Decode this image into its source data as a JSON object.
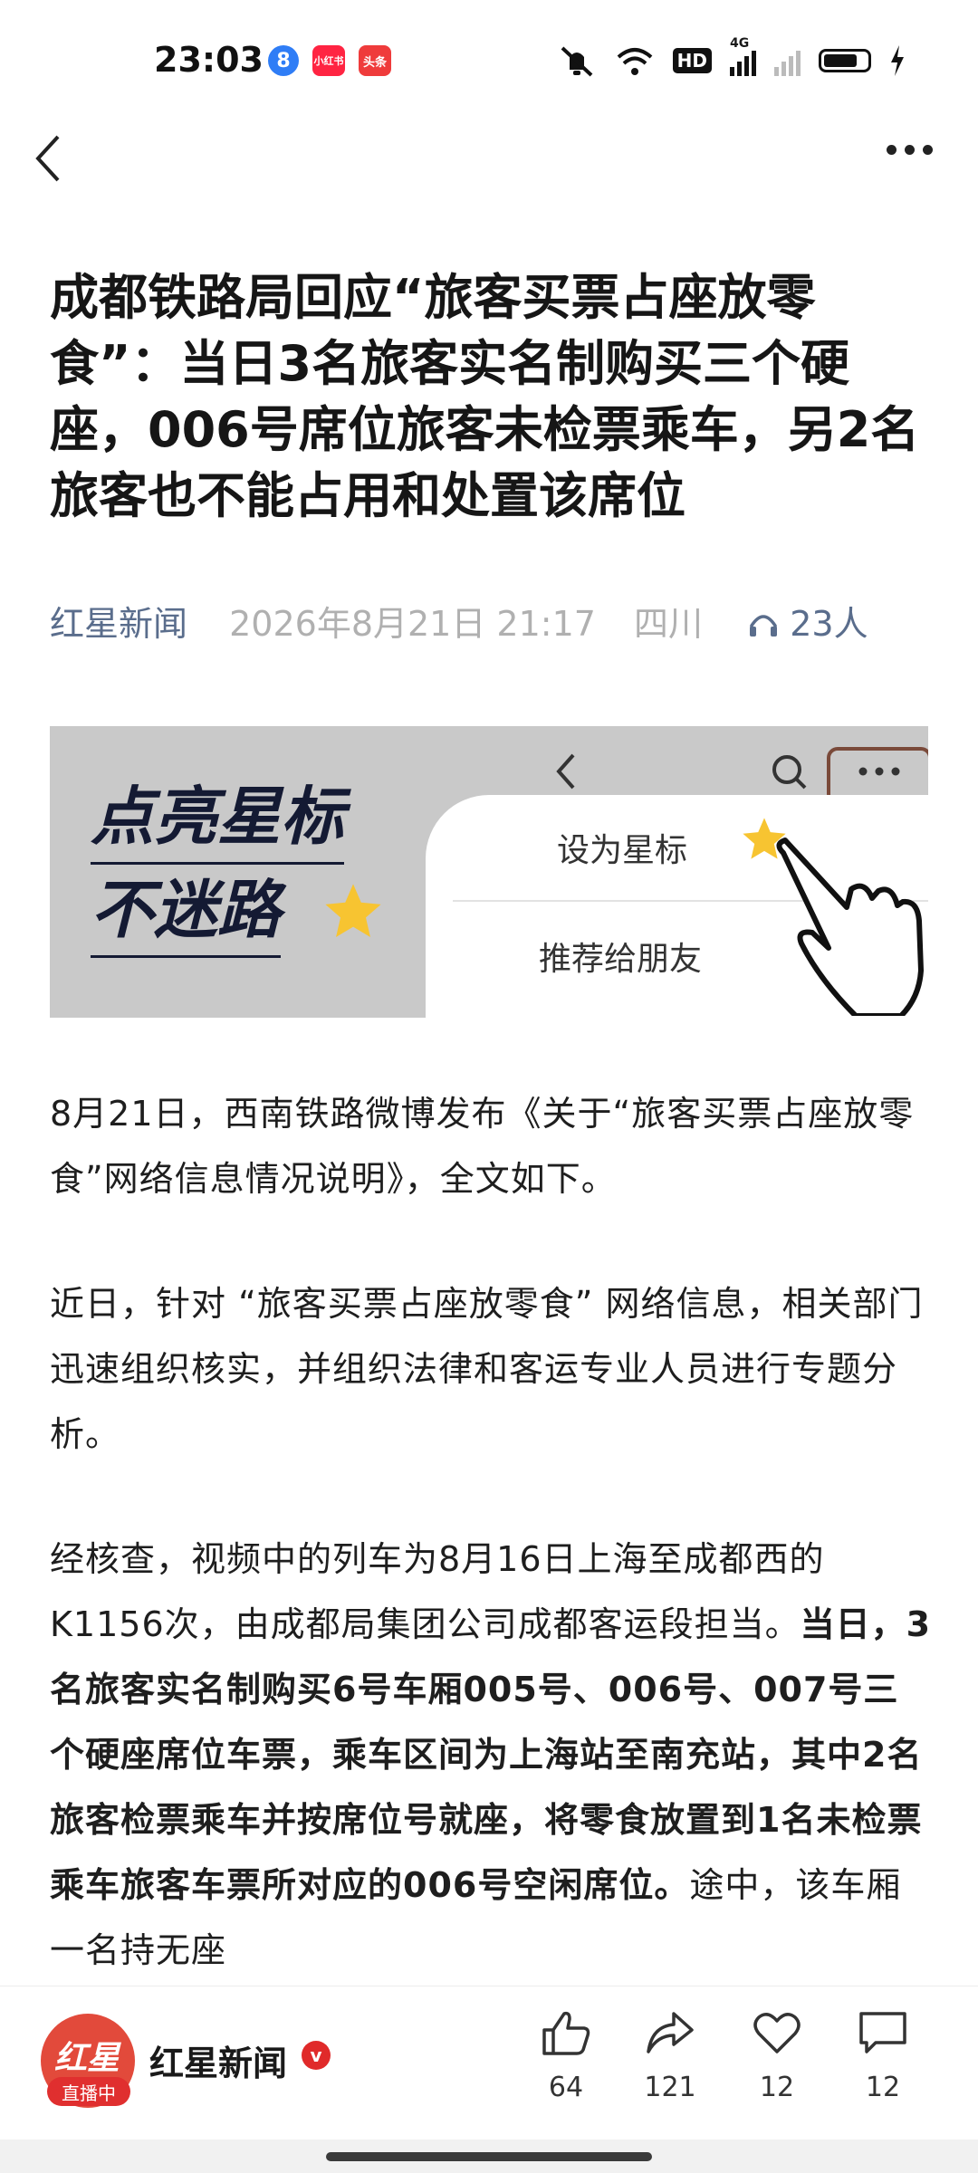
{
  "status_bar": {
    "time": "23:03",
    "badges": [
      "8",
      "小红书",
      "头条"
    ],
    "network": "HD",
    "signal_label": "4G"
  },
  "article": {
    "title": "成都铁路局回应“旅客买票占座放零食”：当日3名旅客实名制购买三个硬座，006号席位旅客未检票乘车，另2名旅客也不能占用和处置该席位",
    "source": "红星新闻",
    "datetime": "2026年8月21日 21:17",
    "region": "四川",
    "listeners": "23人"
  },
  "banner": {
    "slogan_line1": "点亮星标",
    "slogan_line2": "不迷路",
    "menu_item_star": "设为星标",
    "menu_item_recommend": "推荐给朋友"
  },
  "body": {
    "p1": "8月21日，西南铁路微博发布《关于“旅客买票占座放零食”网络信息情况说明》，全文如下。",
    "p2": "近日，针对 “旅客买票占座放零食” 网络信息，相关部门迅速组织核实，并组织法律和客运专业人员进行专题分析。",
    "p3_normal": "经核查，视频中的列车为8月16日上海至成都西的K1156次，由成都局集团公司成都客运段担当。",
    "p3_bold": "当日，3名旅客实名制购买6号车厢005号、006号、007号三个硬座席位车票，乘车区间为上海站至南充站，其中2名旅客检票乘车并按席位号就座，将零食放置到1名未检票乘车旅客车票所对应的006号空闲席位。",
    "p3_tail": "途中，该车厢一名持无座"
  },
  "bottom_bar": {
    "account_name": "红星新闻",
    "avatar_text": "红星",
    "live_label": "直播中",
    "verified_mark": "v",
    "likes": "64",
    "shares": "121",
    "favorites": "12",
    "comments": "12"
  },
  "colors": {
    "accent_meta": "#5a6d8c",
    "live_red": "#e02f2f",
    "star_yellow": "#f7c431"
  }
}
